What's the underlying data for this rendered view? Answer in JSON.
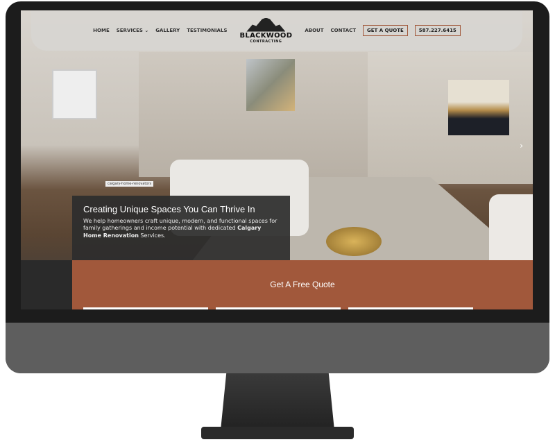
{
  "nav": {
    "items": [
      "HOME",
      "SERVICES",
      "GALLERY",
      "TESTIMONIALS",
      "ABOUT",
      "CONTACT"
    ],
    "dropdown_icon": "chevron-down-icon",
    "quote_button": "GET A QUOTE",
    "phone": "587.227.6415"
  },
  "logo": {
    "name": "BLACKWOOD",
    "sub": "CONTRACTING"
  },
  "hero": {
    "image_tag": "calgary-home-renovators",
    "title": "Creating Unique Spaces You Can Thrive In",
    "text_before": "We help homeowners craft unique, modern, and functional spaces for family gatherings and income potential with dedicated ",
    "text_bold": "Calgary Home Renovation",
    "text_after": " Services.",
    "next_icon": "chevron-right-icon"
  },
  "quote_section": {
    "title": "Get A Free Quote",
    "accent": "#a1583b"
  }
}
